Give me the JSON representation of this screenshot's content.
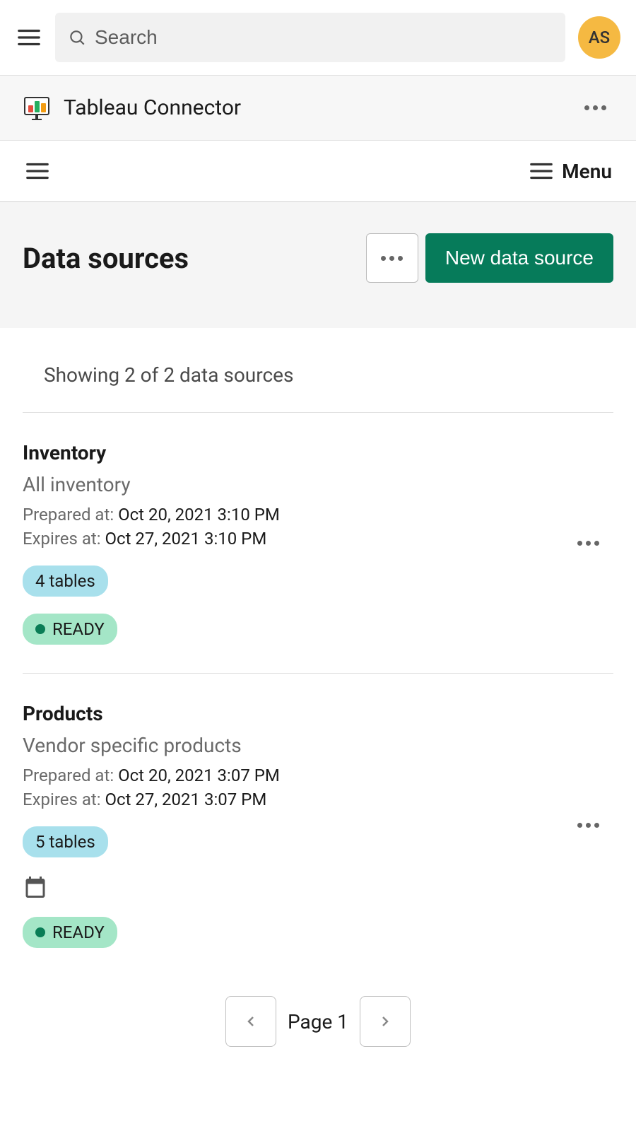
{
  "header": {
    "search_placeholder": "Search",
    "avatar_initials": "AS"
  },
  "app": {
    "title": "Tableau Connector"
  },
  "secondary": {
    "menu_label": "Menu"
  },
  "page": {
    "title": "Data sources",
    "new_button": "New data source"
  },
  "list": {
    "count_text": "Showing 2 of 2 data sources",
    "items": [
      {
        "title": "Inventory",
        "subtitle": "All inventory",
        "prepared_label": "Prepared at: ",
        "prepared_value": "Oct 20, 2021 3:10 PM",
        "expires_label": "Expires at: ",
        "expires_value": "Oct 27, 2021 3:10 PM",
        "tables_badge": "4 tables",
        "status_badge": "READY",
        "has_schedule": false
      },
      {
        "title": "Products",
        "subtitle": "Vendor specific products",
        "prepared_label": "Prepared at: ",
        "prepared_value": "Oct 20, 2021 3:07 PM",
        "expires_label": "Expires at: ",
        "expires_value": "Oct 27, 2021 3:07 PM",
        "tables_badge": "5 tables",
        "status_badge": "READY",
        "has_schedule": true
      }
    ]
  },
  "pagination": {
    "label": "Page 1"
  }
}
